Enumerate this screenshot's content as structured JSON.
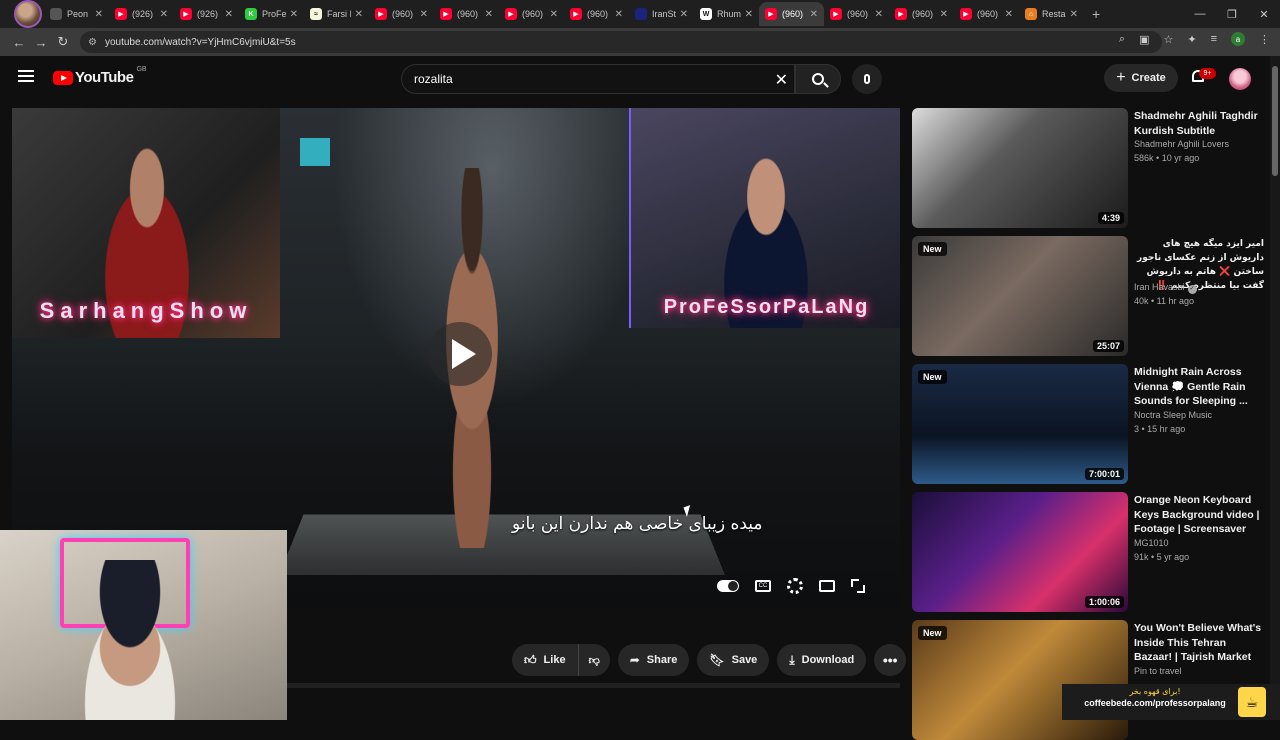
{
  "browser": {
    "tabs": [
      {
        "label": "Peon",
        "favicon_color": "#555555",
        "favicon_glyph": ""
      },
      {
        "label": "(926)",
        "favicon_color": "#ff0033",
        "favicon_glyph": "▶"
      },
      {
        "label": "(926)",
        "favicon_color": "#ff0033",
        "favicon_glyph": "▶"
      },
      {
        "label": "ProFe",
        "favicon_color": "#2ecc40",
        "favicon_glyph": "K"
      },
      {
        "label": "Farsi I",
        "favicon_color": "#f5f5dc",
        "favicon_glyph": "≈"
      },
      {
        "label": "(960)",
        "favicon_color": "#ff0033",
        "favicon_glyph": "▶"
      },
      {
        "label": "(960)",
        "favicon_color": "#ff0033",
        "favicon_glyph": "▶"
      },
      {
        "label": "(960)",
        "favicon_color": "#ff0033",
        "favicon_glyph": "▶"
      },
      {
        "label": "(960)",
        "favicon_color": "#ff0033",
        "favicon_glyph": "▶"
      },
      {
        "label": "IranSt",
        "favicon_color": "#1a237e",
        "favicon_glyph": ""
      },
      {
        "label": "Rhum",
        "favicon_color": "#ffffff",
        "favicon_glyph": "W"
      },
      {
        "label": "(960)",
        "favicon_color": "#ff0033",
        "favicon_glyph": "▶",
        "active": true
      },
      {
        "label": "(960)",
        "favicon_color": "#ff0033",
        "favicon_glyph": "▶"
      },
      {
        "label": "(960)",
        "favicon_color": "#ff0033",
        "favicon_glyph": "▶"
      },
      {
        "label": "(960)",
        "favicon_color": "#ff0033",
        "favicon_glyph": "▶"
      },
      {
        "label": "Resta",
        "favicon_color": "#e67e22",
        "favicon_glyph": "⌂"
      }
    ],
    "new_tab_label": "+",
    "window_controls": {
      "minimize": "—",
      "maximize": "❐",
      "close": "✕"
    },
    "nav": {
      "back": "←",
      "forward": "→",
      "reload": "↻"
    },
    "url": "youtube.com/watch?v=YjHmC6vjmiU&t=5s",
    "profile_initial": "a"
  },
  "masthead": {
    "logo_text": "YouTube",
    "country_code": "GB",
    "search_value": "rozalita",
    "clear_label": "✕",
    "create_label": "Create",
    "notifications_badge": "9+"
  },
  "player": {
    "overlay_left_handle": "SarhangShow",
    "overlay_right_handle": "ProFeSsorPaLaNg",
    "subtitle": "میده زیبای خاصی هم ندارن این بانو"
  },
  "actions": {
    "like_label": "Like",
    "share_label": "Share",
    "save_label": "Save",
    "download_label": "Download",
    "more_label": "•••"
  },
  "recommendations": [
    {
      "title": "Shadmehr Aghili Taghdir Kurdish Subtitle",
      "channel": "Shadmehr Aghili Lovers",
      "views": "586k",
      "age": "10 yr ago",
      "duration": "4:39",
      "is_new": false,
      "rtl": false,
      "verified": false,
      "thumb": "linear-gradient(135deg, #dcdcdc, #5a5a5a 40%, #1b1b1b)"
    },
    {
      "title": "امیر ایزد میگه هیچ های داریوش از زنم عکسای ناجور ساختن ❌ هاتم به داریوش گفت بیا منتظره کنیم ‼️",
      "channel": "Iran Havashi",
      "views": "40k",
      "age": "11 hr ago",
      "duration": "25:07",
      "is_new": true,
      "rtl": true,
      "verified": true,
      "thumb": "linear-gradient(135deg, #3a3a3a, #7a6a60 45%, #2a2a2a)"
    },
    {
      "title": "Midnight Rain Across Vienna 💭 Gentle Rain Sounds for Sleeping ...",
      "channel": "Noctra Sleep Music",
      "views": "3",
      "age": "15 hr ago",
      "duration": "7:00:01",
      "is_new": true,
      "rtl": false,
      "verified": false,
      "thumb": "linear-gradient(180deg, #1a2a44, #0b1424 60%, #2e5a8a)"
    },
    {
      "title": "Orange Neon Keyboard Keys Background video | Footage | Screensaver",
      "channel": "MG1010",
      "views": "91k",
      "age": "5 yr ago",
      "duration": "1:00:06",
      "is_new": false,
      "rtl": false,
      "verified": false,
      "thumb": "linear-gradient(135deg, #1b0f3a, #5a1f8a 40%, #d8306a 70%, #2a0a3a)"
    },
    {
      "title": "You Won't Believe What's Inside This Tehran Bazaar! | Tajrish Market",
      "channel": "Pin to travel",
      "views": "",
      "age": "",
      "duration": "",
      "is_new": true,
      "rtl": false,
      "verified": false,
      "thumb": "linear-gradient(135deg, #5a3a1a, #c08a3a 45%, #2a1a0a)"
    }
  ],
  "coffee_widget": {
    "persian_text": "برای قهوه بخر!",
    "url": "coffeebede.com/professorpalang"
  }
}
